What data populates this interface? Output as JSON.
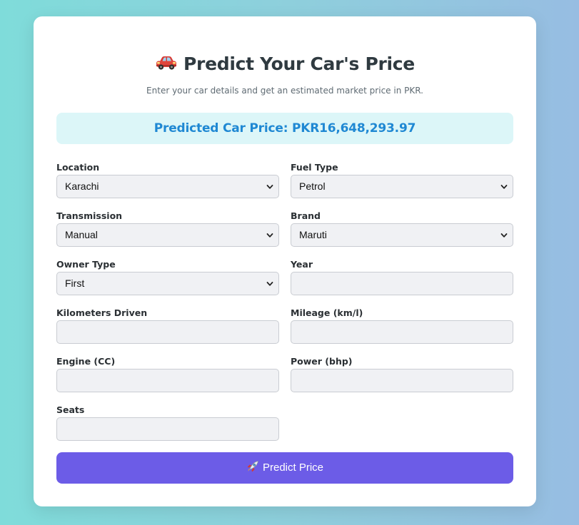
{
  "page": {
    "title": "Predict Your Car's Price",
    "title_icon": "car-icon",
    "subtitle": "Enter your car details and get an estimated market price in PKR.",
    "result": "Predicted Car Price: PKR16,648,293.97"
  },
  "form": {
    "location": {
      "label": "Location",
      "value": "Karachi"
    },
    "fuel_type": {
      "label": "Fuel Type",
      "value": "Petrol"
    },
    "transmission": {
      "label": "Transmission",
      "value": "Manual"
    },
    "brand": {
      "label": "Brand",
      "value": "Maruti"
    },
    "owner_type": {
      "label": "Owner Type",
      "value": "First"
    },
    "year": {
      "label": "Year",
      "value": ""
    },
    "kilometers_driven": {
      "label": "Kilometers Driven",
      "value": ""
    },
    "mileage": {
      "label": "Mileage (km/l)",
      "value": ""
    },
    "engine": {
      "label": "Engine (CC)",
      "value": ""
    },
    "power": {
      "label": "Power (bhp)",
      "value": ""
    },
    "seats": {
      "label": "Seats",
      "value": ""
    }
  },
  "button": {
    "label": "Predict Price",
    "icon": "rocket-icon"
  },
  "colors": {
    "accent": "#6c5ce7",
    "result_text": "#1f88d3",
    "result_bg": "#dcf6f8",
    "card_bg": "#ffffff"
  }
}
